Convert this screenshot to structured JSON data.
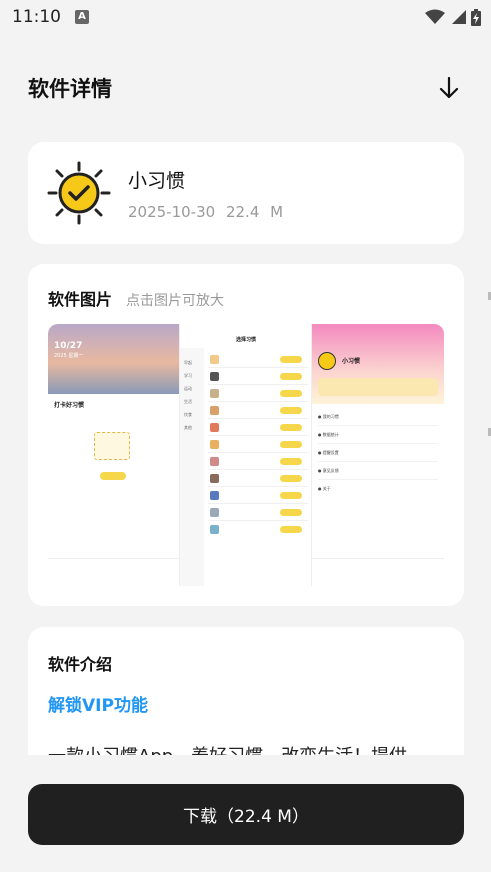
{
  "status_bar": {
    "time": "11:10",
    "notification_icon": "a-icon",
    "right_icons": [
      "wifi-icon",
      "signal-icon",
      "battery-charging-icon"
    ]
  },
  "header": {
    "title": "软件详情",
    "action_icon": "arrow-down-icon"
  },
  "app": {
    "name": "小习惯",
    "date": "2025-10-30",
    "size": "22.4 M",
    "icon": "sun-check-icon",
    "accent_color": "#f6c919"
  },
  "screenshots": {
    "title": "软件图片",
    "hint": "点击图片可放大",
    "shot1": {
      "date": "10/27",
      "weekday": "2025 星期一",
      "section": "打卡好习惯",
      "empty": "还没有习惯"
    },
    "shot2": {
      "title": "选择习惯",
      "categories": [
        "早起",
        "学习",
        "运动",
        "生活",
        "饮食",
        "其他"
      ],
      "button": "添加"
    },
    "shot3": {
      "name": "小习惯",
      "banner": "开通会员",
      "menu": [
        "我的习惯",
        "数据统计",
        "提醒设置",
        "意见反馈",
        "关于"
      ]
    }
  },
  "intro": {
    "title": "软件介绍",
    "vip": "解锁VIP功能",
    "description": "一款小习惯App，养好习惯，改变生活！提供"
  },
  "download": {
    "label": "下载（22.4 M）"
  },
  "colors": {
    "background": "#f3f3f3",
    "card": "#ffffff",
    "link": "#2196f3",
    "button": "#202020"
  }
}
